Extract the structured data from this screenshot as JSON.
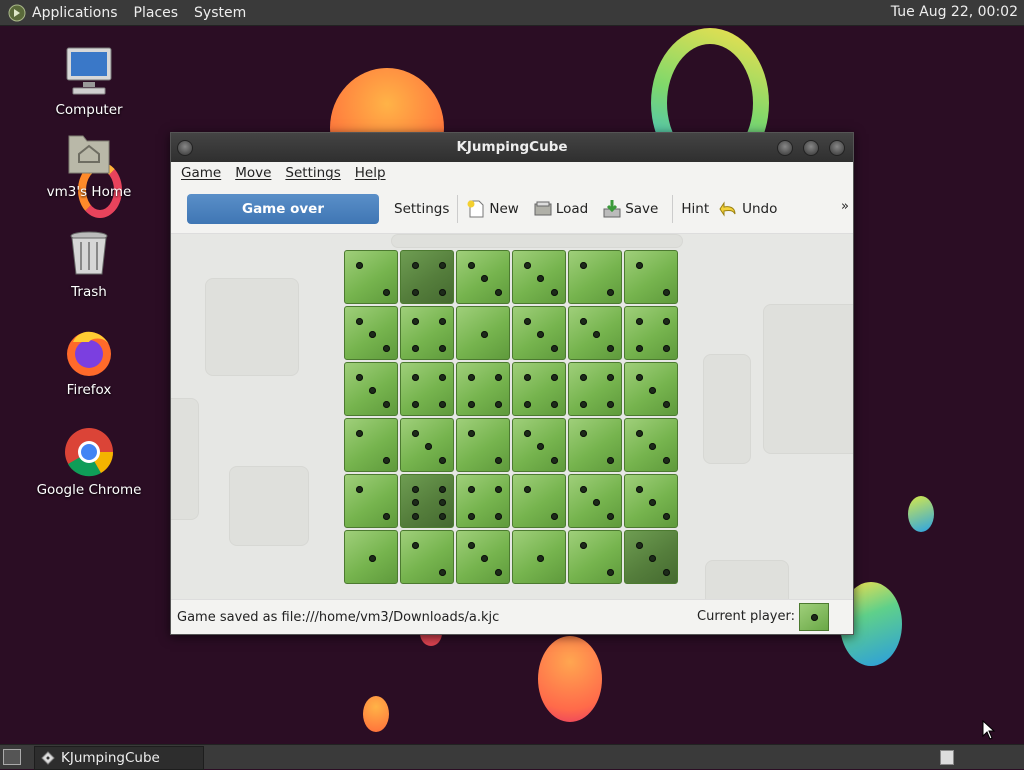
{
  "top_panel": {
    "menus": [
      "Applications",
      "Places",
      "System"
    ],
    "clock": "Tue Aug 22, 00:02"
  },
  "desktop": {
    "icons": [
      {
        "label": "Computer",
        "icon": "computer-icon"
      },
      {
        "label": "vm3's Home",
        "icon": "home-folder-icon"
      },
      {
        "label": "Trash",
        "icon": "trash-icon"
      },
      {
        "label": "Firefox",
        "icon": "firefox-icon"
      },
      {
        "label": "Google Chrome",
        "icon": "chrome-icon"
      }
    ]
  },
  "window": {
    "title": "KJumpingCube",
    "menu": [
      "Game",
      "Move",
      "Settings",
      "Help"
    ],
    "toolbar": {
      "status_button": "Game over",
      "settings": "Settings",
      "new": "New",
      "load": "Load",
      "save": "Save",
      "hint": "Hint",
      "undo": "Undo",
      "overflow": "»"
    },
    "board": {
      "size": 6,
      "note": "pip counts per cube, row-major; dark = owned by second player",
      "cubes": [
        [
          {
            "pips": 2,
            "dark": false
          },
          {
            "pips": 4,
            "dark": true
          },
          {
            "pips": 3,
            "dark": false
          },
          {
            "pips": 3,
            "dark": false
          },
          {
            "pips": 2,
            "dark": false
          },
          {
            "pips": 2,
            "dark": false
          }
        ],
        [
          {
            "pips": 3,
            "dark": false
          },
          {
            "pips": 4,
            "dark": false
          },
          {
            "pips": 1,
            "dark": false
          },
          {
            "pips": 3,
            "dark": false
          },
          {
            "pips": 3,
            "dark": false
          },
          {
            "pips": 4,
            "dark": false
          }
        ],
        [
          {
            "pips": 3,
            "dark": false
          },
          {
            "pips": 4,
            "dark": false
          },
          {
            "pips": 4,
            "dark": false
          },
          {
            "pips": 4,
            "dark": false
          },
          {
            "pips": 4,
            "dark": false
          },
          {
            "pips": 3,
            "dark": false
          }
        ],
        [
          {
            "pips": 2,
            "dark": false
          },
          {
            "pips": 3,
            "dark": false
          },
          {
            "pips": 2,
            "dark": false
          },
          {
            "pips": 3,
            "dark": false
          },
          {
            "pips": 2,
            "dark": false
          },
          {
            "pips": 3,
            "dark": false
          }
        ],
        [
          {
            "pips": 2,
            "dark": false
          },
          {
            "pips": 6,
            "dark": true
          },
          {
            "pips": 4,
            "dark": false
          },
          {
            "pips": 2,
            "dark": false
          },
          {
            "pips": 3,
            "dark": false
          },
          {
            "pips": 3,
            "dark": false
          }
        ],
        [
          {
            "pips": 1,
            "dark": false
          },
          {
            "pips": 2,
            "dark": false
          },
          {
            "pips": 3,
            "dark": false
          },
          {
            "pips": 1,
            "dark": false
          },
          {
            "pips": 2,
            "dark": false
          },
          {
            "pips": 3,
            "dark": true
          }
        ]
      ]
    },
    "status": {
      "message": "Game saved as file:///home/vm3/Downloads/a.kjc",
      "current_player_label": "Current player:"
    }
  },
  "taskbar": {
    "tasks": [
      {
        "label": "KJumpingCube",
        "icon": "kjumpingcube-icon"
      }
    ]
  },
  "colors": {
    "wallpaper": "#2b0d24",
    "panel": "#3a3a3a",
    "cube_green": "#7cb854",
    "cube_dark": "#557e3c",
    "accent_button": "#4a81bd"
  }
}
